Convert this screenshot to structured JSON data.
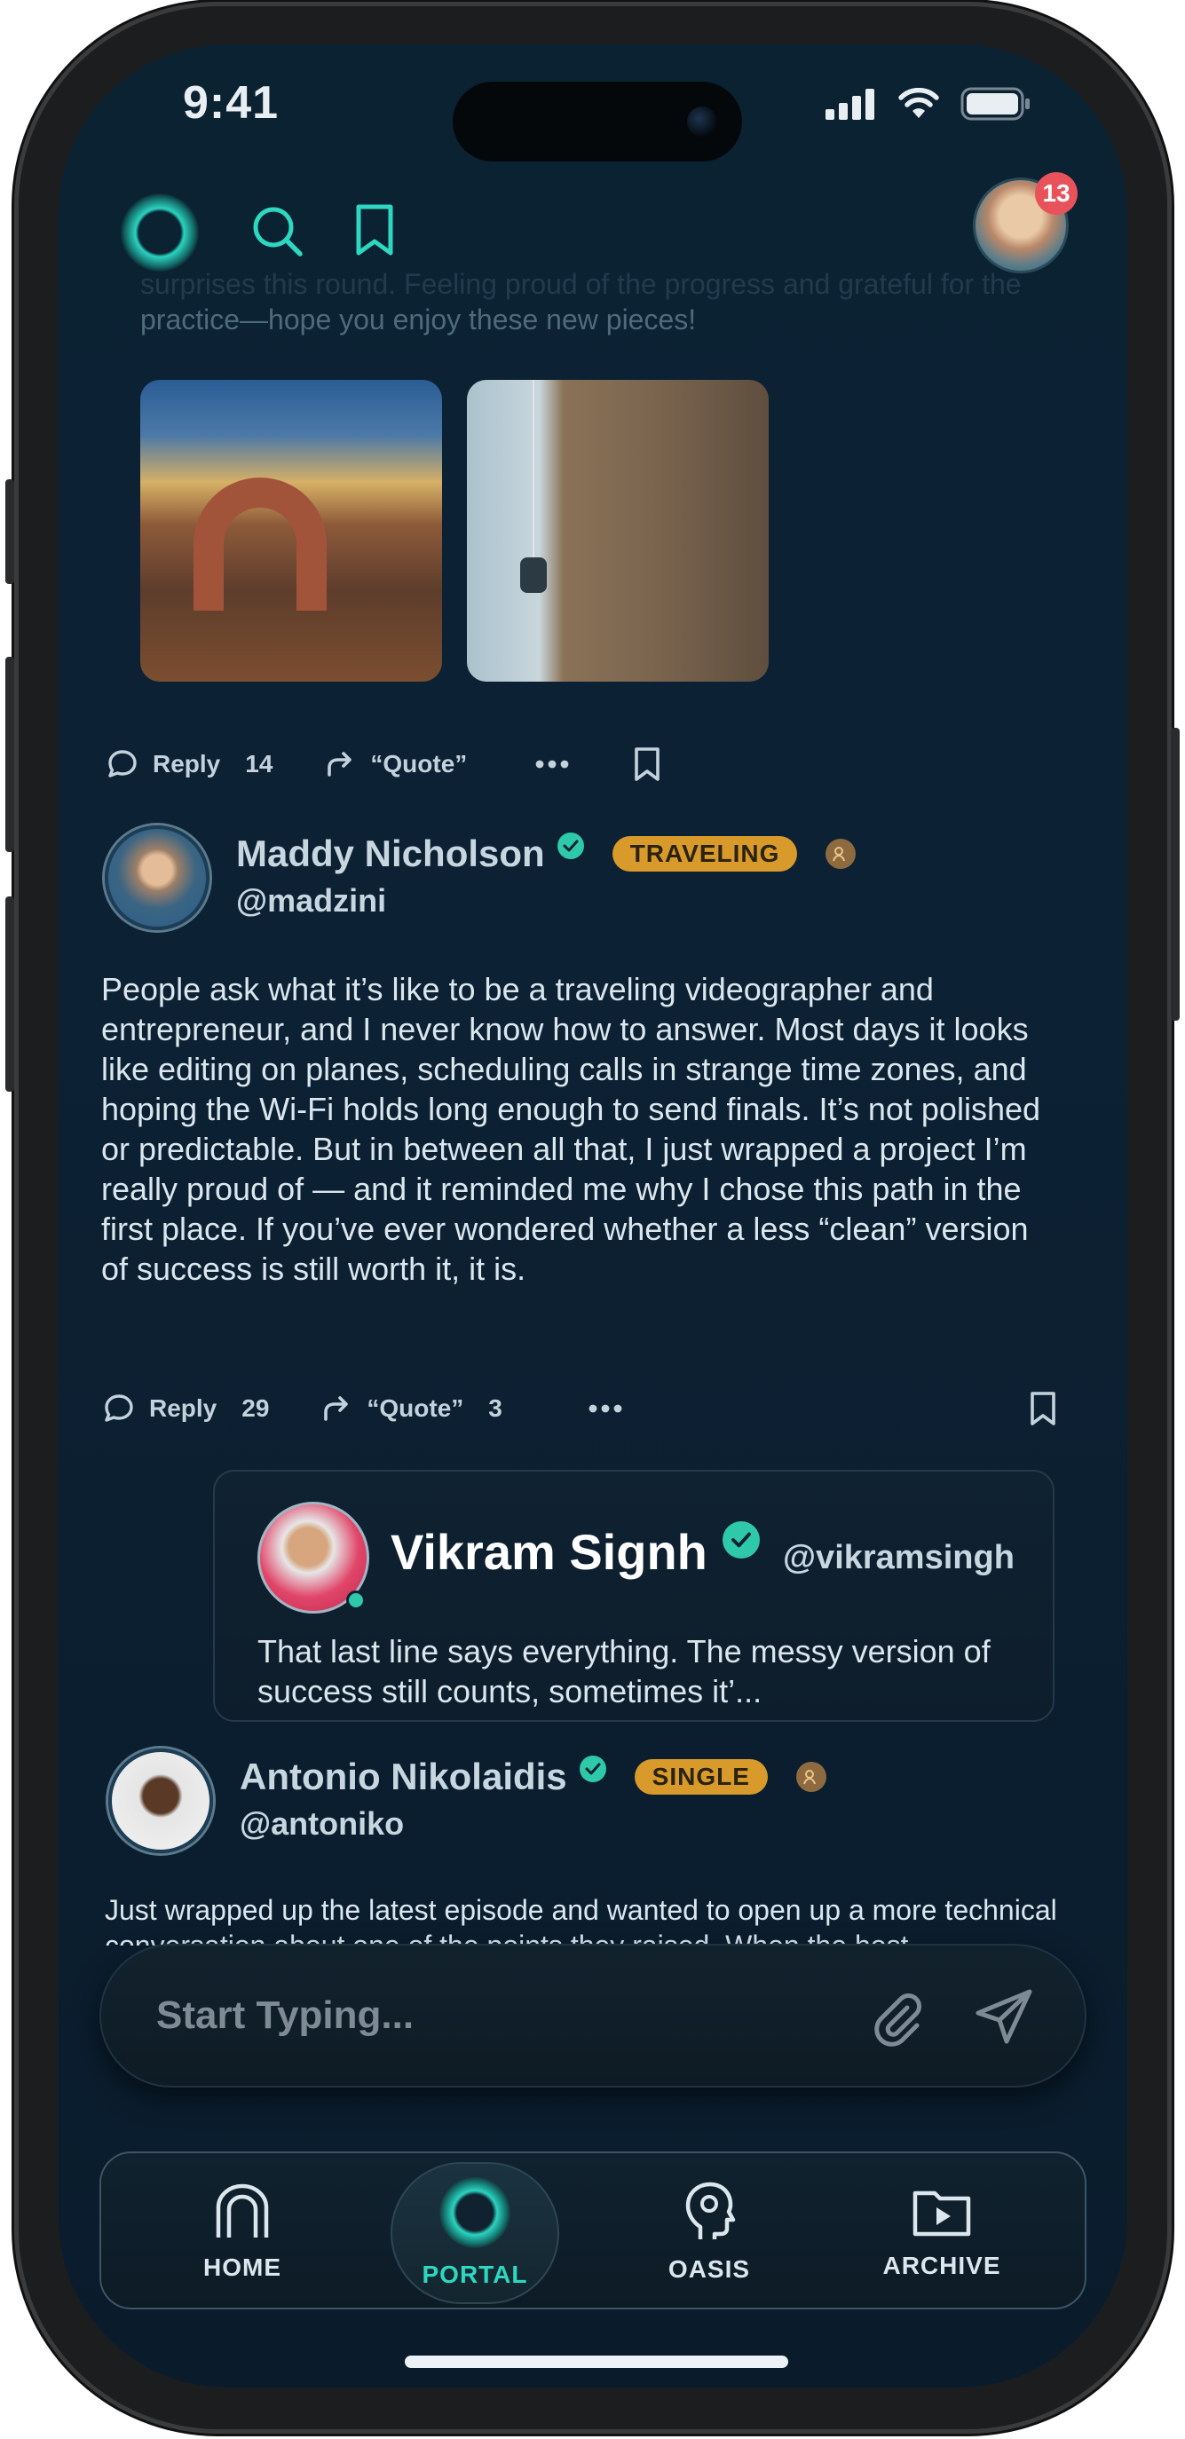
{
  "status_bar": {
    "time": "9:41"
  },
  "top_nav": {
    "notification_count": "13"
  },
  "faded_post": {
    "text_line1": "surprises this round. Feeling proud of the progress and grateful for the",
    "text_line2": "practice—hope you enjoy these new pieces!",
    "reply_label": "Reply",
    "reply_count": "14",
    "quote_label": "“Quote”"
  },
  "post_maddy": {
    "name": "Maddy Nicholson",
    "status_pill": "TRAVELING",
    "handle": "@madzini",
    "text": "People ask what it’s like to be a traveling videographer and entrepreneur, and I never know how to answer. Most days it looks like editing on planes, scheduling calls in strange time zones, and hoping the Wi-Fi holds long enough to send finals. It’s not polished or predictable. But in between all that, I just wrapped a project I’m really proud of — and it reminded me why I chose this path in the first place. If you’ve ever wondered whether a less “clean” version of success is still worth it, it is.",
    "reply_label": "Reply",
    "reply_count": "29",
    "quote_label": "“Quote”",
    "quote_count": "3"
  },
  "quote_reply": {
    "name": "Vikram Signh",
    "handle": "@vikramsingh",
    "text": "That last line says everything. The messy version of success still counts, sometimes it’..."
  },
  "post_antonio": {
    "name": "Antonio Nikolaidis",
    "status_pill": "SINGLE",
    "handle": "@antoniko",
    "text": "Just wrapped up the latest episode and wanted to open up a more technical conversation about one of the points they raised. When the host"
  },
  "composer": {
    "placeholder": "Start Typing..."
  },
  "bottom_nav": {
    "items": [
      {
        "label": "HOME"
      },
      {
        "label": "PORTAL"
      },
      {
        "label": "OASIS"
      },
      {
        "label": "ARCHIVE"
      }
    ]
  },
  "colors": {
    "accent": "#2ed7bf",
    "pill": "#d89a2a",
    "badge": "#e8525b",
    "background": "#0b2233"
  }
}
